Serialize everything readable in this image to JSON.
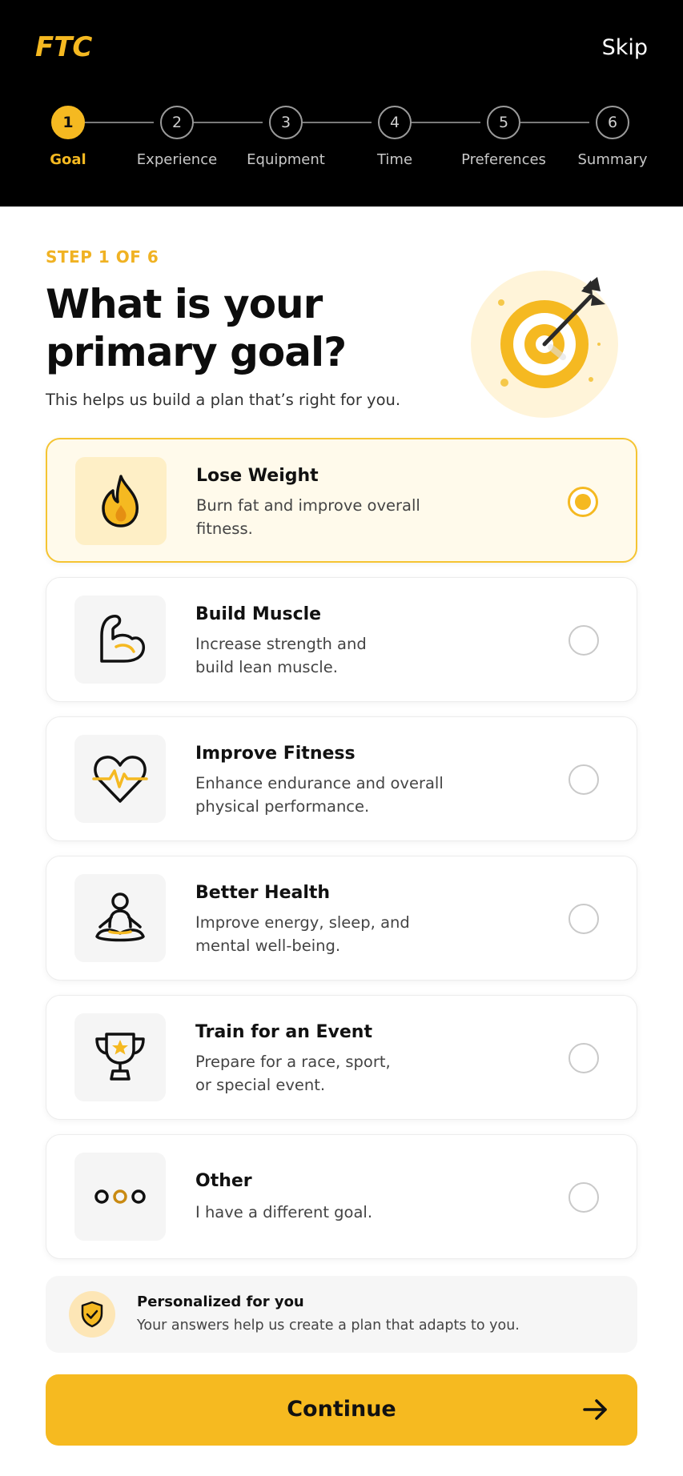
{
  "header": {
    "logo_text": "FTC",
    "skip_label": "Skip"
  },
  "stepper": {
    "steps": [
      {
        "number": "1",
        "label": "Goal",
        "active": true
      },
      {
        "number": "2",
        "label": "Experience",
        "active": false
      },
      {
        "number": "3",
        "label": "Equipment",
        "active": false
      },
      {
        "number": "4",
        "label": "Time",
        "active": false
      },
      {
        "number": "5",
        "label": "Preferences",
        "active": false
      },
      {
        "number": "6",
        "label": "Summary",
        "active": false
      }
    ]
  },
  "main": {
    "step_count": "STEP 1 OF 6",
    "title_line1": "What is your",
    "title_line2": "primary goal?",
    "subtitle": "This helps us build a plan that’s right for you."
  },
  "options": [
    {
      "title": "Lose Weight",
      "desc1": "Burn fat and improve overall",
      "desc2": "fitness.",
      "icon": "flame-icon",
      "selected": true
    },
    {
      "title": "Build Muscle",
      "desc1": "Increase strength and",
      "desc2": "build lean muscle.",
      "icon": "flexed-bicep-icon",
      "selected": false
    },
    {
      "title": "Improve Fitness",
      "desc1": "Enhance endurance and overall",
      "desc2": "physical performance.",
      "icon": "heart-pulse-icon",
      "selected": false
    },
    {
      "title": "Better Health",
      "desc1": "Improve energy, sleep, and",
      "desc2": "mental well-being.",
      "icon": "meditation-icon",
      "selected": false
    },
    {
      "title": "Train for an Event",
      "desc1": "Prepare for a race, sport,",
      "desc2": "or special event.",
      "icon": "trophy-icon",
      "selected": false
    },
    {
      "title": "Other",
      "desc1": "I have a different goal.",
      "desc2": "",
      "icon": "more-dots-icon",
      "selected": false
    }
  ],
  "info": {
    "title": "Personalized for you",
    "desc": "Your answers help us create a plan that adapts to you.",
    "icon": "shield-check-icon"
  },
  "continue_button": {
    "label": "Continue",
    "icon": "arrow-right-icon"
  },
  "colors": {
    "accent": "#F5B921",
    "header_bg": "#000000",
    "selected_bg": "#FFFAEB"
  }
}
